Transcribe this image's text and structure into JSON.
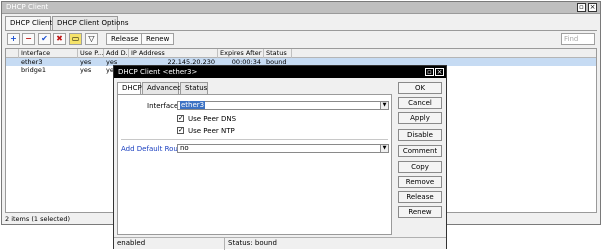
{
  "window": {
    "title": "DHCP Client",
    "close_glyph": "×"
  },
  "tabs": [
    "DHCP Client",
    "DHCP Client Options"
  ],
  "toolbar": {
    "add_icon": "+",
    "remove_icon": "−",
    "enable_icon": "✔",
    "disable_icon": "✖",
    "comment_icon": "▭",
    "filter_icon": "▽",
    "release_label": "Release",
    "renew_label": "Renew",
    "find_placeholder": "Find"
  },
  "table": {
    "columns": [
      "Interface",
      "Use P...",
      "Add D...",
      "IP Address",
      "Expires After",
      "Status"
    ],
    "rows": [
      [
        "ether3",
        "yes",
        "yes",
        "22.145.20.230",
        "00:00:34",
        "bound"
      ],
      [
        "bridge1",
        "yes",
        "yes",
        "",
        "",
        ""
      ]
    ]
  },
  "status_bar": "2 items (1 selected)",
  "dialog": {
    "title": "DHCP Client <ether3>",
    "tabs": [
      "DHCP",
      "Advanced",
      "Status"
    ],
    "interface_label": "Interface:",
    "interface_value": "ether3",
    "use_peer_dns_label": "Use Peer DNS",
    "use_peer_ntp_label": "Use Peer NTP",
    "add_default_route_label": "Add Default Route:",
    "add_default_route_value": "no",
    "check_glyph": "✓",
    "dropdown_glyph": "▼",
    "buttons": [
      "OK",
      "Cancel",
      "Apply",
      "Disable",
      "Comment",
      "Copy",
      "Remove",
      "Release",
      "Renew"
    ],
    "status_left": "enabled",
    "status_right": "Status: bound"
  }
}
